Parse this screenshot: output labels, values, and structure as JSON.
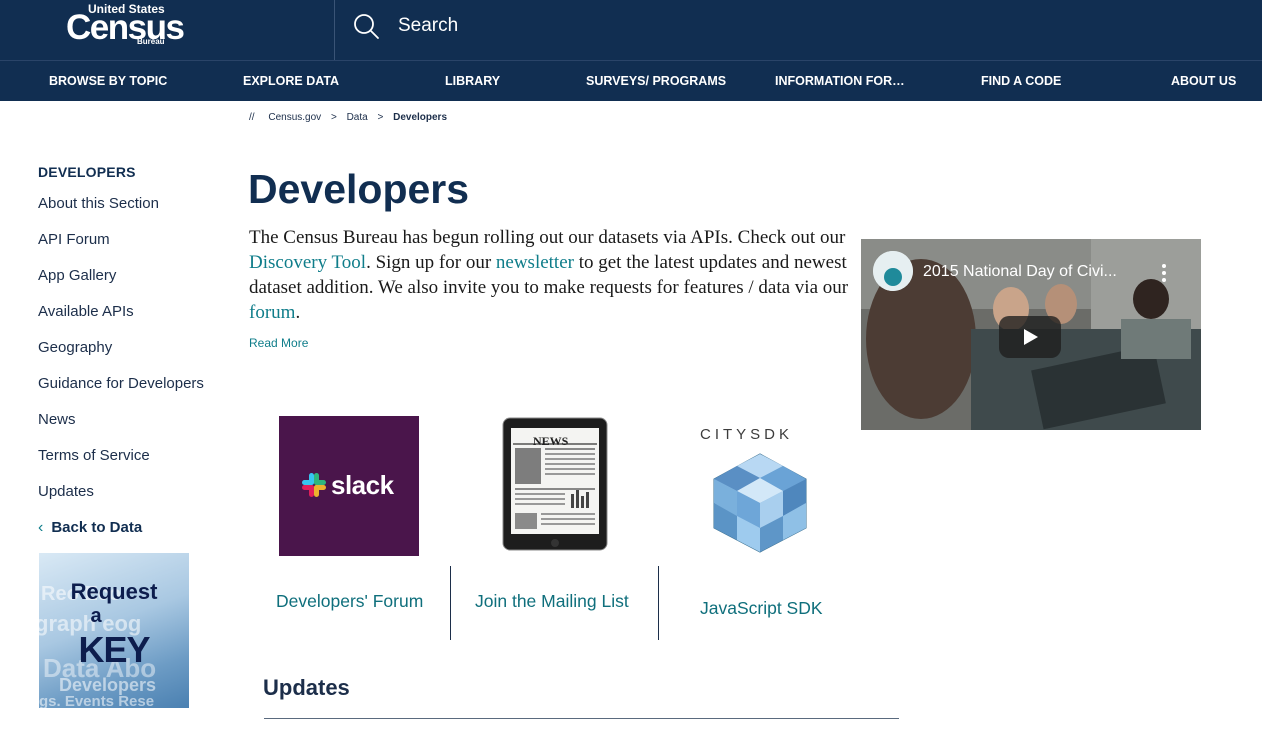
{
  "header": {
    "logo": {
      "top": "United States",
      "main": "Census",
      "bottom": "Bureau"
    },
    "search_placeholder": "Search"
  },
  "nav": [
    {
      "label": "BROWSE BY TOPIC"
    },
    {
      "label": "EXPLORE DATA"
    },
    {
      "label": "LIBRARY"
    },
    {
      "label": "SURVEYS/ PROGRAMS"
    },
    {
      "label": "INFORMATION FOR…"
    },
    {
      "label": "FIND A CODE"
    },
    {
      "label": "ABOUT US"
    }
  ],
  "breadcrumb": {
    "prefix": "//",
    "items": [
      "Census.gov",
      "Data",
      "Developers"
    ],
    "separator": ">"
  },
  "sidebar": {
    "title": "DEVELOPERS",
    "items": [
      "About this Section",
      "API Forum",
      "App Gallery",
      "Available APIs",
      "Geography",
      "Guidance for Developers",
      "News",
      "Terms of Service",
      "Updates"
    ],
    "back_label": "Back to Data",
    "request_key": {
      "line1": "Request",
      "line2": "a",
      "line3": "KEY"
    }
  },
  "main": {
    "title": "Developers",
    "intro": {
      "part1": "The Census Bureau has begun rolling out our datasets via APIs.  Check out our ",
      "link1": "Discovery Tool",
      "part2": ". Sign up for our ",
      "link2": "newsletter",
      "part3": " to get the latest updates and newest dataset addition. We also invite you to make requests for features / data via our ",
      "link3": "forum",
      "part4": "."
    },
    "read_more": "Read More",
    "video": {
      "title": "2015 National Day of Civi..."
    },
    "cards": [
      {
        "label": "Developers' Forum",
        "image_text": "slack"
      },
      {
        "label": "Join the Mailing List",
        "image_text": "NEWS"
      },
      {
        "label": "JavaScript SDK",
        "image_text": "CITYSDK"
      }
    ],
    "updates_title": "Updates"
  },
  "colors": {
    "header_bg": "#112e51",
    "link": "#0f7d8a",
    "slack_bg": "#4a154b"
  }
}
